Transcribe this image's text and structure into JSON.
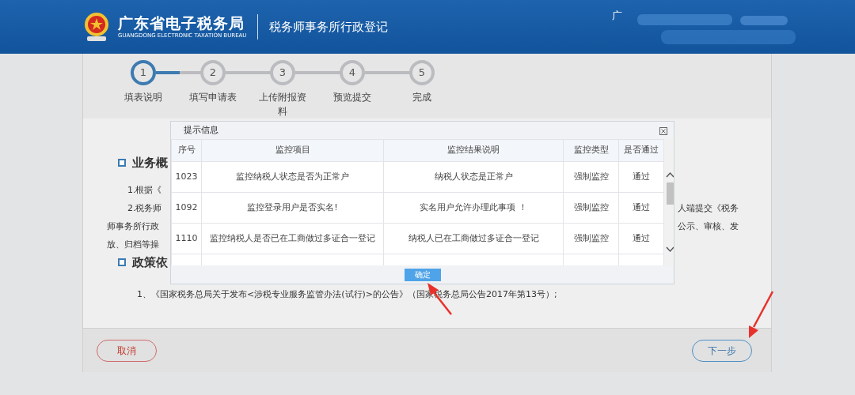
{
  "header": {
    "title": "广东省电子税务局",
    "subtitle": "GUANGDONG ELECTRONIC TAXATION BUREAU",
    "module": "税务师事务所行政登记",
    "user": "广"
  },
  "steps": [
    {
      "number": "1",
      "label": "填表说明",
      "selected": true
    },
    {
      "number": "2",
      "label": "填写申请表",
      "selected": false
    },
    {
      "number": "3",
      "label": "上传附报资料",
      "selected": false
    },
    {
      "number": "4",
      "label": "预览提交",
      "selected": false
    },
    {
      "number": "5",
      "label": "完成",
      "selected": false
    }
  ],
  "content": {
    "sections": [
      {
        "heading": "业务概",
        "lines": [
          {
            "kind": "start",
            "left": "1.根据《"
          },
          {
            "kind": "start",
            "left": "2.税务师",
            "right": "人端提交《税务"
          },
          {
            "kind": "continuation",
            "left": "师事务所行政",
            "right": "公示、审核、发"
          },
          {
            "kind": "continuation",
            "left": "放、归档等操"
          }
        ]
      },
      {
        "heading": "政策依",
        "lines": [
          {
            "kind": "full",
            "text": "1、《国家税务总局关于发布<涉税专业服务监管办法(试行)>的公告》（国家税务总局公告2017年第13号）;"
          }
        ]
      }
    ]
  },
  "dialog": {
    "title": "提示信息",
    "columns": [
      "序号",
      "监控项目",
      "监控结果说明",
      "监控类型",
      "是否通过"
    ],
    "rows": [
      {
        "cells": [
          "1023",
          "监控纳税人状态是否为正常户",
          "纳税人状态是正常户",
          "强制监控",
          "通过"
        ]
      },
      {
        "cells": [
          "1092",
          "监控登录用户是否实名!",
          "实名用户允许办理此事项 ！",
          "强制监控",
          "通过"
        ]
      },
      {
        "cells": [
          "1110",
          "监控纳税人是否已在工商做过多证合一登记",
          "纳税人已在工商做过多证合一登记",
          "强制监控",
          "通过"
        ]
      }
    ],
    "button": "确定"
  },
  "footer": {
    "cancel": "取消",
    "next": "下一步"
  }
}
